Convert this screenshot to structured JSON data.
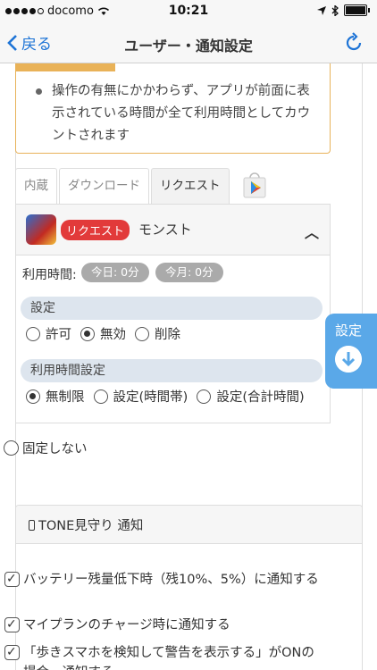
{
  "status_bar": {
    "carrier": "docomo",
    "time": "10:21"
  },
  "nav": {
    "back_label": "戻る",
    "title": "ユーザー・通知設定"
  },
  "notice": {
    "text": "操作の有無にかかわらず、アプリが前面に表示されている時間が全て利用時間としてカウントされます"
  },
  "tabs": [
    {
      "label": "内蔵",
      "active": false
    },
    {
      "label": "ダウンロード",
      "active": false
    },
    {
      "label": "リクエスト",
      "active": true
    }
  ],
  "app": {
    "badge": "リクエスト",
    "name": "モンスト",
    "usage_label": "利用時間:",
    "today": "今日: 0分",
    "month": "今月: 0分"
  },
  "settings": {
    "heading": "設定",
    "options": [
      {
        "label": "許可",
        "selected": false
      },
      {
        "label": "無効",
        "selected": true
      },
      {
        "label": "削除",
        "selected": false
      }
    ]
  },
  "time_settings": {
    "heading": "利用時間設定",
    "options": [
      {
        "label": "無制限",
        "selected": true
      },
      {
        "label": "設定(時間帯)",
        "selected": false
      },
      {
        "label": "設定(合計時間)",
        "selected": false
      }
    ]
  },
  "float_button": {
    "label": "設定"
  },
  "no_fix": {
    "label": "固定しない"
  },
  "tone_notify": {
    "title": "TONE見守り 通知",
    "items": [
      {
        "label": "バッテリー残量低下時（残10%、5%）に通知する",
        "checked": true
      },
      {
        "label": "マイプランのチャージ時に通知する",
        "checked": true
      },
      {
        "label": "「歩きスマホを検知して警告を表示する」がONの場合、通知する",
        "checked": true
      }
    ]
  },
  "colors": {
    "accent": "#1e74d6",
    "badge": "#e23a3a",
    "notice_border": "#e8b25a",
    "float": "#5aa8e8"
  }
}
